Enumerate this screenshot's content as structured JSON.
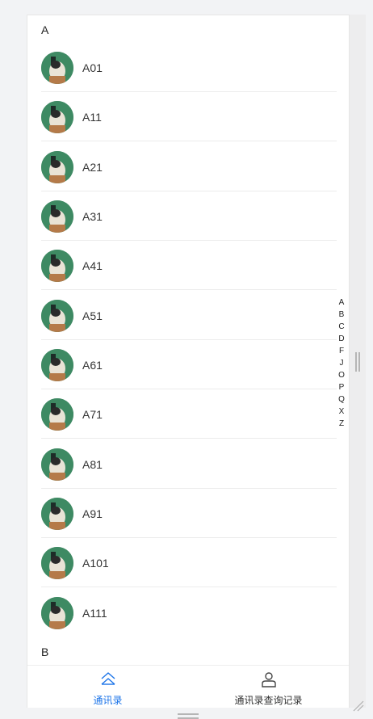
{
  "sections": [
    {
      "letter": "A",
      "contacts": [
        "A01",
        "A11",
        "A21",
        "A31",
        "A41",
        "A51",
        "A61",
        "A71",
        "A81",
        "A91",
        "A101",
        "A111"
      ]
    },
    {
      "letter": "B",
      "contacts": []
    }
  ],
  "index_letters": [
    "A",
    "B",
    "C",
    "D",
    "F",
    "J",
    "O",
    "P",
    "Q",
    "X",
    "Z"
  ],
  "tabbar": {
    "tabs": [
      {
        "label": "通讯录",
        "icon": "home-icon",
        "active": true
      },
      {
        "label": "通讯录查询记录",
        "icon": "user-icon",
        "active": false
      }
    ]
  },
  "colors": {
    "accent": "#1a73e8",
    "divider": "#ececec",
    "background": "#f2f3f5"
  }
}
